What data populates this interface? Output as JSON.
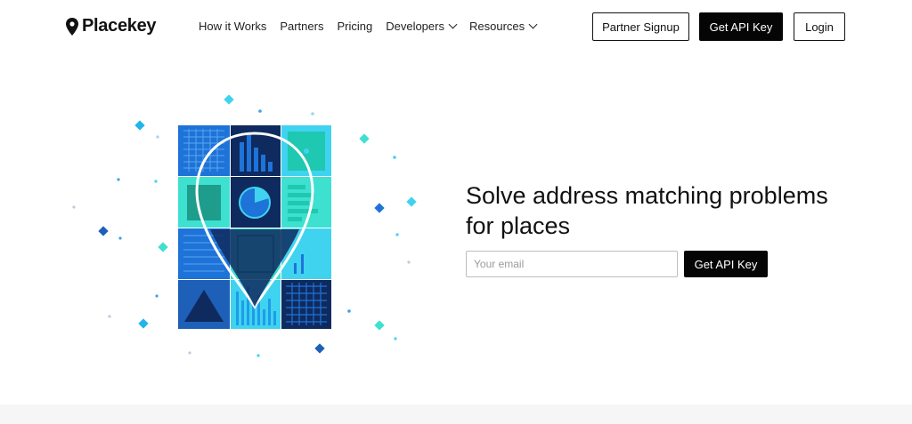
{
  "header": {
    "brand": "Placekey",
    "nav": [
      {
        "label": "How it Works",
        "dropdown": false
      },
      {
        "label": "Partners",
        "dropdown": false
      },
      {
        "label": "Pricing",
        "dropdown": false
      },
      {
        "label": "Developers",
        "dropdown": true
      },
      {
        "label": "Resources",
        "dropdown": true
      }
    ],
    "partner_signup": "Partner Signup",
    "get_api_key": "Get API Key",
    "login": "Login"
  },
  "hero": {
    "headline_line1": "Solve address matching problems",
    "headline_line2": "for places",
    "email_placeholder": "Your email",
    "cta_label": "Get API Key"
  },
  "colors": {
    "primary_button": "#050505",
    "illustration_dark": "#0f2a5e",
    "illustration_blue": "#1e73d8",
    "illustration_cyan": "#3fd3f0",
    "illustration_teal": "#1fc8b0"
  }
}
